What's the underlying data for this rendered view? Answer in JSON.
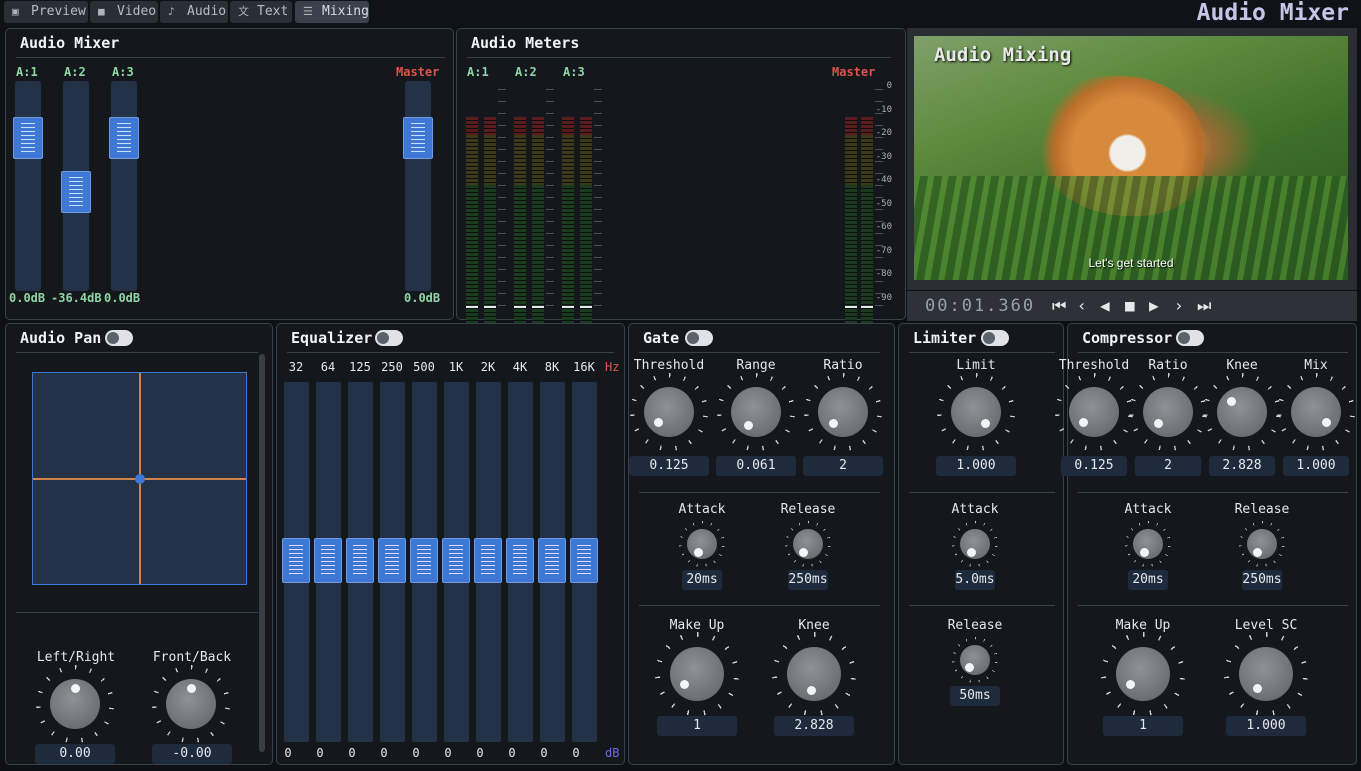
{
  "app": {
    "title": "Audio Mixer"
  },
  "tabs": [
    {
      "label": "Preview",
      "icon": "preview-icon",
      "glyph": "▣"
    },
    {
      "label": "Video",
      "icon": "video-icon",
      "glyph": "■"
    },
    {
      "label": "Audio",
      "icon": "music-note-icon",
      "glyph": "♪"
    },
    {
      "label": "Text",
      "icon": "translate-icon",
      "glyph": "文"
    },
    {
      "label": "Mixing",
      "icon": "sliders-icon",
      "glyph": "☰"
    }
  ],
  "mixer": {
    "title": "Audio Mixer",
    "channels": [
      {
        "label": "A:1",
        "db": "0.0dB",
        "level": 0.0
      },
      {
        "label": "A:2",
        "db": "-36.4dB",
        "level": -36.4
      },
      {
        "label": "A:3",
        "db": "0.0dB",
        "level": 0.0
      }
    ],
    "master": {
      "label": "Master",
      "db": "0.0dB",
      "level": 0.0
    }
  },
  "meters": {
    "title": "Audio Meters",
    "channels": [
      "A:1",
      "A:2",
      "A:3"
    ],
    "master": "Master",
    "scale": [
      "0",
      "-10",
      "-20",
      "-30",
      "-40",
      "-50",
      "-60",
      "-70",
      "-80",
      "-90"
    ]
  },
  "preview": {
    "overlay_title": "Audio Mixing",
    "subtitle": "Let's get started",
    "timecode": "00:01.360"
  },
  "pan": {
    "title": "Audio Pan",
    "left_right_label": "Left/Right",
    "front_back_label": "Front/Back",
    "left_right_value": "0.00",
    "front_back_value": "-0.00"
  },
  "eq": {
    "title": "Equalizer",
    "bands": [
      "32",
      "64",
      "125",
      "250",
      "500",
      "1K",
      "2K",
      "4K",
      "8K",
      "16K"
    ],
    "values": [
      "0",
      "0",
      "0",
      "0",
      "0",
      "0",
      "0",
      "0",
      "0",
      "0"
    ],
    "hz_label": "Hz",
    "db_label": "dB"
  },
  "gate": {
    "title": "Gate",
    "threshold_label": "Threshold",
    "threshold": "0.125",
    "range_label": "Range",
    "range": "0.061",
    "ratio_label": "Ratio",
    "ratio": "2",
    "attack_label": "Attack",
    "attack": "20ms",
    "release_label": "Release",
    "release": "250ms",
    "makeup_label": "Make Up",
    "makeup": "1",
    "knee_label": "Knee",
    "knee": "2.828"
  },
  "limiter": {
    "title": "Limiter",
    "limit_label": "Limit",
    "limit": "1.000",
    "attack_label": "Attack",
    "attack": "5.0ms",
    "release_label": "Release",
    "release": "50ms"
  },
  "compressor": {
    "title": "Compressor",
    "threshold_label": "Threshold",
    "threshold": "0.125",
    "ratio_label": "Ratio",
    "ratio": "2",
    "knee_label": "Knee",
    "knee": "2.828",
    "mix_label": "Mix",
    "mix": "1.000",
    "attack_label": "Attack",
    "attack": "20ms",
    "release_label": "Release",
    "release": "250ms",
    "makeup_label": "Make Up",
    "makeup": "1",
    "levelsc_label": "Level SC",
    "levelsc": "1.000"
  },
  "colors": {
    "accent": "#3e78d4",
    "master": "#e0534a",
    "green": "#8fd6a4",
    "pan_cross": "#d0844a"
  }
}
